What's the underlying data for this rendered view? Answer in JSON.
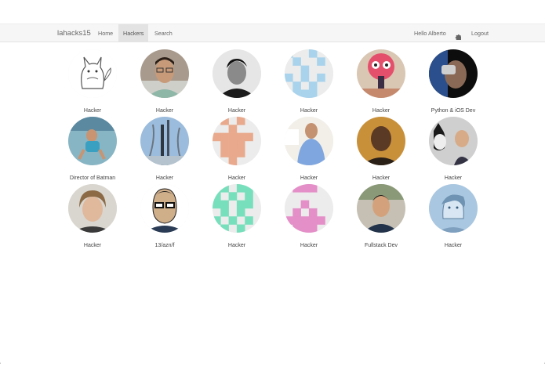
{
  "navbar": {
    "brand": "lahacks15",
    "items": [
      {
        "label": "Home"
      },
      {
        "label": "Hackers"
      },
      {
        "label": "Search"
      }
    ],
    "greeting": "Hello Alberto",
    "logout": "Logout"
  },
  "hackers": [
    {
      "caption": "Hacker",
      "avatar": "totoro-sketch"
    },
    {
      "caption": "Hacker",
      "avatar": "photo-glasses"
    },
    {
      "caption": "Hacker",
      "avatar": "photo-bw"
    },
    {
      "caption": "Hacker",
      "avatar": "identicon-blue"
    },
    {
      "caption": "Hacker",
      "avatar": "photo-pink-monster"
    },
    {
      "caption": "Python & iOS Dev",
      "avatar": "photo-vr"
    },
    {
      "caption": "Director of Batman",
      "avatar": "photo-pool"
    },
    {
      "caption": "Hacker",
      "avatar": "photo-city"
    },
    {
      "caption": "Hacker",
      "avatar": "identicon-salmon"
    },
    {
      "caption": "Hacker",
      "avatar": "photo-blue-shirt"
    },
    {
      "caption": "Hacker",
      "avatar": "photo-orange"
    },
    {
      "caption": "Hacker",
      "avatar": "photo-husky"
    },
    {
      "caption": "Hacker",
      "avatar": "photo-blond"
    },
    {
      "caption": "13/azn/f",
      "avatar": "cartoon-glasses"
    },
    {
      "caption": "Hacker",
      "avatar": "identicon-teal"
    },
    {
      "caption": "Hacker",
      "avatar": "identicon-pink"
    },
    {
      "caption": "Fullstack Dev",
      "avatar": "photo-fullstack"
    },
    {
      "caption": "Hacker",
      "avatar": "sketch-blue"
    }
  ],
  "colors": {
    "identicon_blue": "#a9d3ec",
    "identicon_salmon": "#e9a98c",
    "identicon_teal": "#78dfbc",
    "identicon_pink": "#e48fc8"
  }
}
